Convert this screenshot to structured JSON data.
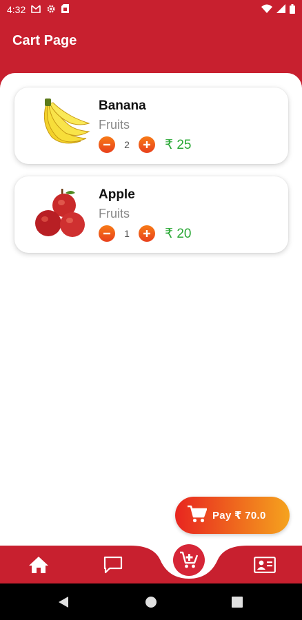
{
  "status_bar": {
    "time": "4:32",
    "icons": [
      "gmail-icon",
      "settings-icon",
      "sim-card-icon",
      "wifi-icon",
      "signal-icon",
      "battery-icon"
    ]
  },
  "app_bar": {
    "title": "Cart Page"
  },
  "cart": {
    "items": [
      {
        "name": "Banana",
        "category": "Fruits",
        "quantity": "2",
        "price": "₹ 25",
        "image_icon": "banana-icon"
      },
      {
        "name": "Apple",
        "category": "Fruits",
        "quantity": "1",
        "price": "₹ 20",
        "image_icon": "apple-icon"
      }
    ]
  },
  "pay_button": {
    "label": "Pay ₹ 70.0",
    "icon": "cart-icon"
  },
  "bottom_nav": {
    "items": [
      "home-icon",
      "chat-icon",
      "add-to-cart-icon",
      "contact-card-icon"
    ],
    "active": "add-to-cart-icon"
  },
  "colors": {
    "primary": "#c8202f",
    "accent_orange": "#f07318",
    "price_green": "#2aa836",
    "category_gray": "#888888"
  }
}
